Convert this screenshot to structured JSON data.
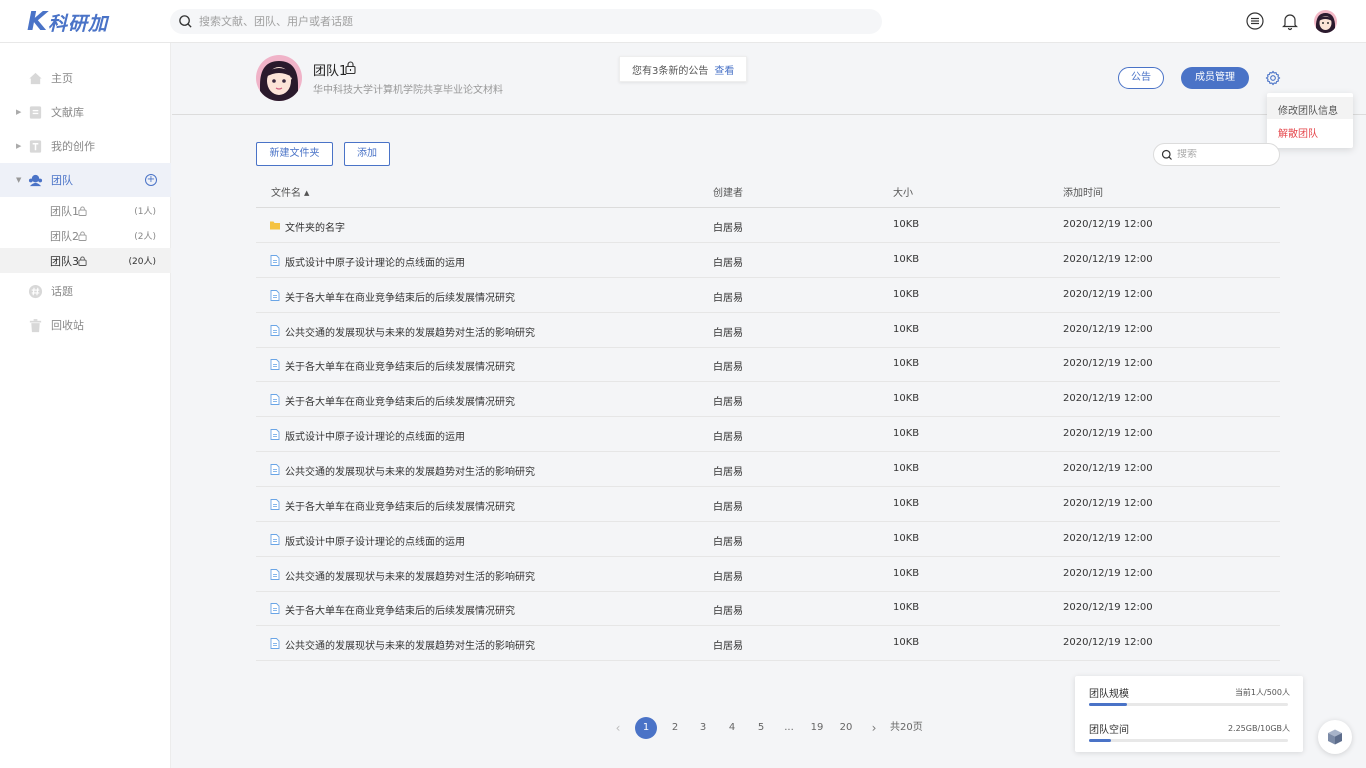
{
  "brand": {
    "logo_k": "K",
    "logo_text": "科研加"
  },
  "topbar": {
    "search_placeholder": "搜索文献、团队、用户或者话题",
    "icons": [
      "menu-icon",
      "bell-icon",
      "user-avatar"
    ]
  },
  "sidebar": {
    "items": [
      {
        "label": "主页",
        "icon": "home-icon"
      },
      {
        "label": "文献库",
        "icon": "library-icon"
      },
      {
        "label": "我的创作",
        "icon": "text-icon"
      },
      {
        "label": "团队",
        "icon": "team-icon"
      },
      {
        "label": "话题",
        "icon": "hash-icon"
      },
      {
        "label": "回收站",
        "icon": "trash-icon"
      }
    ],
    "teams": [
      {
        "label": "团队1",
        "count": "(1人)"
      },
      {
        "label": "团队2",
        "count": "(2人)"
      },
      {
        "label": "团队3",
        "count": "(20人)"
      }
    ],
    "add_symbol": "+"
  },
  "team": {
    "name": "团队1",
    "description": "华中科技大学计算机学院共享毕业论文材料",
    "notice_text": "您有3条新的公告",
    "notice_view": "查看",
    "btn_notice": "公告",
    "btn_members": "成员管理"
  },
  "dropdown": {
    "edit": "修改团队信息",
    "dissolve": "解散团队"
  },
  "toolbar": {
    "new_folder": "新建文件夹",
    "add": "添加",
    "search_placeholder": "搜索"
  },
  "table": {
    "headers": {
      "name": "文件名",
      "creator": "创建者",
      "size": "大小",
      "time": "添加时间"
    },
    "rows": [
      {
        "type": "folder",
        "name": "文件夹的名字",
        "creator": "白居易",
        "size": "10KB",
        "time": "2020/12/19 12:00"
      },
      {
        "type": "file",
        "name": "版式设计中原子设计理论的点线面的运用",
        "creator": "白居易",
        "size": "10KB",
        "time": "2020/12/19 12:00"
      },
      {
        "type": "file",
        "name": "关于各大单车在商业竞争结束后的后续发展情况研究",
        "creator": "白居易",
        "size": "10KB",
        "time": "2020/12/19 12:00"
      },
      {
        "type": "file",
        "name": "公共交通的发展现状与未来的发展趋势对生活的影响研究",
        "creator": "白居易",
        "size": "10KB",
        "time": "2020/12/19 12:00"
      },
      {
        "type": "file",
        "name": "关于各大单车在商业竞争结束后的后续发展情况研究",
        "creator": "白居易",
        "size": "10KB",
        "time": "2020/12/19 12:00"
      },
      {
        "type": "file",
        "name": "关于各大单车在商业竞争结束后的后续发展情况研究",
        "creator": "白居易",
        "size": "10KB",
        "time": "2020/12/19 12:00"
      },
      {
        "type": "file",
        "name": "版式设计中原子设计理论的点线面的运用",
        "creator": "白居易",
        "size": "10KB",
        "time": "2020/12/19 12:00"
      },
      {
        "type": "file",
        "name": "公共交通的发展现状与未来的发展趋势对生活的影响研究",
        "creator": "白居易",
        "size": "10KB",
        "time": "2020/12/19 12:00"
      },
      {
        "type": "file",
        "name": "关于各大单车在商业竞争结束后的后续发展情况研究",
        "creator": "白居易",
        "size": "10KB",
        "time": "2020/12/19 12:00"
      },
      {
        "type": "file",
        "name": "版式设计中原子设计理论的点线面的运用",
        "creator": "白居易",
        "size": "10KB",
        "time": "2020/12/19 12:00"
      },
      {
        "type": "file",
        "name": "公共交通的发展现状与未来的发展趋势对生活的影响研究",
        "creator": "白居易",
        "size": "10KB",
        "time": "2020/12/19 12:00"
      },
      {
        "type": "file",
        "name": "关于各大单车在商业竞争结束后的后续发展情况研究",
        "creator": "白居易",
        "size": "10KB",
        "time": "2020/12/19 12:00"
      },
      {
        "type": "file",
        "name": "公共交通的发展现状与未来的发展趋势对生活的影响研究",
        "creator": "白居易",
        "size": "10KB",
        "time": "2020/12/19 12:00"
      }
    ]
  },
  "pagination": {
    "pages": [
      "1",
      "2",
      "3",
      "4",
      "5",
      "...",
      "19",
      "20"
    ],
    "current": "1",
    "total": "共20页",
    "prev": "‹",
    "next": "›"
  },
  "stats": {
    "scale_label": "团队规模",
    "scale_value": "当前1人/500人",
    "scale_fraction": 0.19,
    "space_label": "团队空间",
    "space_value": "2.25GB/10GB人",
    "space_fraction": 0.11
  },
  "colors": {
    "accent": "#4a73c7",
    "danger": "#e5484d"
  }
}
